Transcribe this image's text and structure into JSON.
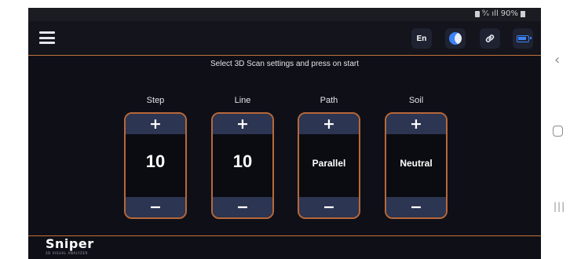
{
  "status_bar": {
    "text": "☉ ⁹⁄ₛ 🛈 90%",
    "battery": "90%"
  },
  "appbar": {
    "menu_icon": "hamburger-icon",
    "language_label": "En",
    "theme_icon": "half-moon-icon",
    "link_icon": "link-icon",
    "battery_icon": "battery-icon"
  },
  "instruction": "Select 3D Scan settings and press on start",
  "controls": [
    {
      "label": "Step",
      "value": "10",
      "plus": "+",
      "minus": "−"
    },
    {
      "label": "Line",
      "value": "10",
      "plus": "+",
      "minus": "−"
    },
    {
      "label": "Path",
      "value": "Parallel",
      "plus": "+",
      "minus": "−"
    },
    {
      "label": "Soil",
      "value": "Neutral",
      "plus": "+",
      "minus": "−"
    }
  ],
  "logo": {
    "text": "Sniper",
    "subtitle": "3D VISUAL ANALYZER"
  },
  "system_nav": {
    "back": "‹",
    "recents": "|||"
  },
  "colors": {
    "background": "#0f1017",
    "accent_line": "#c2703a",
    "button_fill": "#2c3551",
    "icon_blue": "#3b82f6"
  }
}
